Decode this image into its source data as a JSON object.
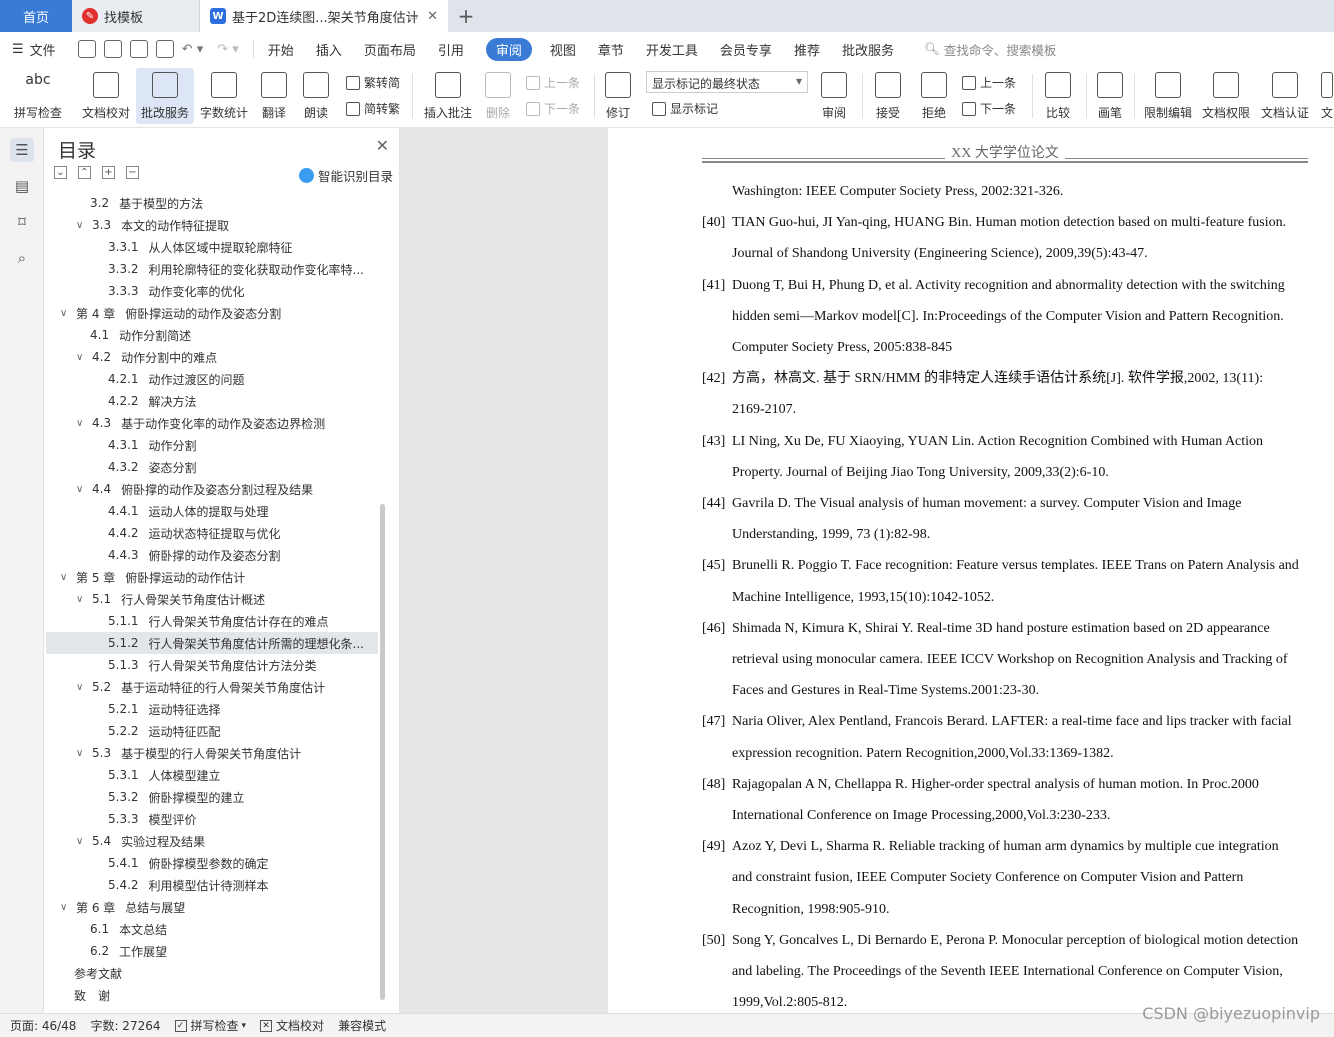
{
  "tabs": {
    "home": "首页",
    "template": "找模板",
    "doc": "基于2D连续图...架关节角度估计",
    "add": "+"
  },
  "menu": {
    "file": "文件",
    "items": [
      "开始",
      "插入",
      "页面布局",
      "引用",
      "审阅",
      "视图",
      "章节",
      "开发工具",
      "会员专享",
      "推荐",
      "批改服务"
    ],
    "active_index": 4,
    "search": "查找命令、搜索模板"
  },
  "ribbon": {
    "spell": "拼写检查",
    "doc_check": "文档校对",
    "correct_service": "批改服务",
    "word_count": "字数统计",
    "translate": "翻译",
    "read": "朗读",
    "trad": "繁转简",
    "simp": "简转繁",
    "insert_comment": "插入批注",
    "delete": "删除",
    "prev1": "上一条",
    "next1": "下一条",
    "revise": "修订",
    "markup_state": "显示标记的最终状态",
    "show_markup": "显示标记",
    "review": "审阅",
    "accept": "接受",
    "reject": "拒绝",
    "prev2": "上一条",
    "next2": "下一条",
    "compare": "比较",
    "pen": "画笔",
    "restrict": "限制编辑",
    "doc_rights": "文档权限",
    "doc_auth": "文档认证",
    "more": "文"
  },
  "toc": {
    "title": "目录",
    "ai_label": "智能识别目录",
    "items": [
      {
        "level": 2,
        "arrow": "",
        "num": "3.2",
        "text": "基于模型的方法"
      },
      {
        "level": 2,
        "arrow": "∨",
        "num": "3.3",
        "text": "本文的动作特征提取"
      },
      {
        "level": 3,
        "arrow": "",
        "num": "3.3.1",
        "text": "从人体区域中提取轮廓特征"
      },
      {
        "level": 3,
        "arrow": "",
        "num": "3.3.2",
        "text": "利用轮廓特征的变化获取动作变化率特..."
      },
      {
        "level": 3,
        "arrow": "",
        "num": "3.3.3",
        "text": "动作变化率的优化"
      },
      {
        "level": 1,
        "arrow": "∨",
        "num": "第 4 章",
        "text": "俯卧撑运动的动作及姿态分割"
      },
      {
        "level": 2,
        "arrow": "",
        "num": "4.1",
        "text": "动作分割简述"
      },
      {
        "level": 2,
        "arrow": "∨",
        "num": "4.2",
        "text": "动作分割中的难点"
      },
      {
        "level": 3,
        "arrow": "",
        "num": "4.2.1",
        "text": "动作过渡区的问题"
      },
      {
        "level": 3,
        "arrow": "",
        "num": "4.2.2",
        "text": "解决方法"
      },
      {
        "level": 2,
        "arrow": "∨",
        "num": "4.3",
        "text": "基于动作变化率的动作及姿态边界检测"
      },
      {
        "level": 3,
        "arrow": "",
        "num": "4.3.1",
        "text": "动作分割"
      },
      {
        "level": 3,
        "arrow": "",
        "num": "4.3.2",
        "text": "姿态分割"
      },
      {
        "level": 2,
        "arrow": "∨",
        "num": "4.4",
        "text": "俯卧撑的动作及姿态分割过程及结果"
      },
      {
        "level": 3,
        "arrow": "",
        "num": "4.4.1",
        "text": "运动人体的提取与处理"
      },
      {
        "level": 3,
        "arrow": "",
        "num": "4.4.2",
        "text": "运动状态特征提取与优化"
      },
      {
        "level": 3,
        "arrow": "",
        "num": "4.4.3",
        "text": "俯卧撑的动作及姿态分割"
      },
      {
        "level": 1,
        "arrow": "∨",
        "num": "第 5 章",
        "text": "俯卧撑运动的动作估计"
      },
      {
        "level": 2,
        "arrow": "∨",
        "num": "5.1",
        "text": "行人骨架关节角度估计概述"
      },
      {
        "level": 3,
        "arrow": "",
        "num": "5.1.1",
        "text": "行人骨架关节角度估计存在的难点"
      },
      {
        "level": 3,
        "arrow": "",
        "num": "5.1.2",
        "text": "行人骨架关节角度估计所需的理想化条...",
        "selected": true
      },
      {
        "level": 3,
        "arrow": "",
        "num": "5.1.3",
        "text": "行人骨架关节角度估计方法分类"
      },
      {
        "level": 2,
        "arrow": "∨",
        "num": "5.2",
        "text": "基于运动特征的行人骨架关节角度估计"
      },
      {
        "level": 3,
        "arrow": "",
        "num": "5.2.1",
        "text": "运动特征选择"
      },
      {
        "level": 3,
        "arrow": "",
        "num": "5.2.2",
        "text": "运动特征匹配"
      },
      {
        "level": 2,
        "arrow": "∨",
        "num": "5.3",
        "text": "基于模型的行人骨架关节角度估计"
      },
      {
        "level": 3,
        "arrow": "",
        "num": "5.3.1",
        "text": "人体模型建立"
      },
      {
        "level": 3,
        "arrow": "",
        "num": "5.3.2",
        "text": "俯卧撑模型的建立"
      },
      {
        "level": 3,
        "arrow": "",
        "num": "5.3.3",
        "text": "模型评价"
      },
      {
        "level": 2,
        "arrow": "∨",
        "num": "5.4",
        "text": "实验过程及结果"
      },
      {
        "level": 3,
        "arrow": "",
        "num": "5.4.1",
        "text": "俯卧撑模型参数的确定"
      },
      {
        "level": 3,
        "arrow": "",
        "num": "5.4.2",
        "text": "利用模型估计待测样本"
      },
      {
        "level": 1,
        "arrow": "∨",
        "num": "第 6 章",
        "text": "总结与展望"
      },
      {
        "level": 2,
        "arrow": "",
        "num": "6.1",
        "text": "本文总结"
      },
      {
        "level": 2,
        "arrow": "",
        "num": "6.2",
        "text": "工作展望"
      },
      {
        "level": 1,
        "arrow": "",
        "num": "",
        "text": "参考文献"
      },
      {
        "level": 1,
        "arrow": "",
        "num": "",
        "text": "致　谢"
      }
    ]
  },
  "document": {
    "header": "XX 大学学位论文",
    "references": [
      {
        "label": "",
        "lines": [
          "Washington: IEEE Computer Society Press, 2002:321-326."
        ]
      },
      {
        "label": "[40]",
        "lines": [
          "TIAN Guo-hui, JI Yan-qing, HUANG Bin. Human motion detection based on multi-feature fusion.",
          "Journal of Shandong University (Engineering Science), 2009,39(5):43-47."
        ]
      },
      {
        "label": "[41]",
        "lines": [
          "Duong T, Bui H, Phung D, et al. Activity recognition and abnormality detection with the switching",
          "hidden semi—Markov model[C]. In:Proceedings of the Computer Vision and Pattern Recognition.",
          "Computer Society Press, 2005:838-845"
        ]
      },
      {
        "label": "[42]",
        "lines": [
          "方高，林高文. 基于 SRN/HMM 的非特定人连续手语估计系统[J]. 软件学报,2002, 13(11):",
          "2169-2107."
        ]
      },
      {
        "label": "[43]",
        "lines": [
          "LI Ning, Xu De, FU Xiaoying, YUAN Lin. Action Recognition Combined with Human Action",
          "Property. Journal of Beijing Jiao Tong University, 2009,33(2):6-10."
        ]
      },
      {
        "label": "[44]",
        "lines": [
          "Gavrila D. The Visual analysis of human movement: a survey. Computer Vision and Image",
          "Understanding, 1999, 73 (1):82-98."
        ]
      },
      {
        "label": "[45]",
        "lines": [
          "Brunelli R. Poggio T. Face recognition: Feature versus templates. IEEE Trans on Patern Analysis and",
          "Machine Intelligence, 1993,15(10):1042-1052."
        ]
      },
      {
        "label": "[46]",
        "lines": [
          "Shimada N, Kimura K, Shirai Y. Real-time 3D hand posture estimation based on 2D appearance",
          "retrieval using monocular camera. IEEE ICCV Workshop on Recognition Analysis and Tracking of",
          "Faces and Gestures in Real-Time Systems.2001:23-30."
        ]
      },
      {
        "label": "[47]",
        "lines": [
          "Naria Oliver, Alex Pentland, Francois Berard. LAFTER: a real-time face and lips tracker with facial",
          "expression recognition. Patern Recognition,2000,Vol.33:1369-1382."
        ]
      },
      {
        "label": "[48]",
        "lines": [
          "Rajagopalan A N, Chellappa R. Higher-order spectral analysis of human motion. In Proc.2000",
          "International Conference on Image Processing,2000,Vol.3:230-233."
        ]
      },
      {
        "label": "[49]",
        "lines": [
          "Azoz Y, Devi L, Sharma R. Reliable tracking of human arm dynamics by multiple cue integration",
          "and constraint fusion, IEEE Computer Society Conference on Computer Vision and Pattern",
          "Recognition, 1998:905-910."
        ]
      },
      {
        "label": "[50]",
        "lines": [
          "Song Y, Goncalves L, Di Bernardo E, Perona P. Monocular perception of biological motion detection",
          "and labeling. The Proceedings of the Seventh IEEE International Conference on Computer Vision,",
          "1999,Vol.2:805-812."
        ]
      }
    ]
  },
  "status": {
    "page": "页面: 46/48",
    "words": "字数: 27264",
    "spell": "拼写检查",
    "doc_check": "文档校对",
    "compat": "兼容模式",
    "watermark": "CSDN @biyezuopinvip"
  }
}
